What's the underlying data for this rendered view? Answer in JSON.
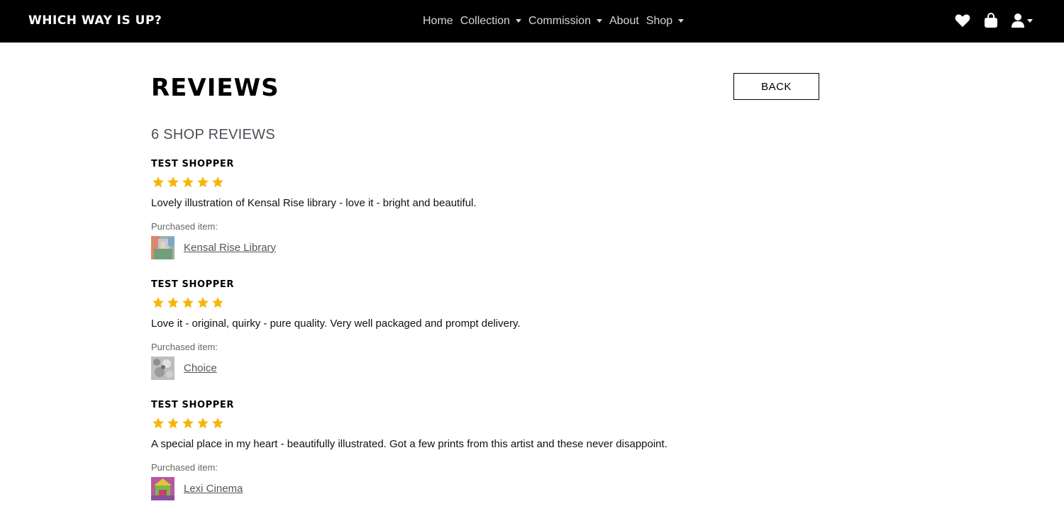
{
  "brand": "Which Way Is Up?",
  "nav": {
    "links": [
      {
        "label": "Home",
        "dropdown": false
      },
      {
        "label": "Collection",
        "dropdown": true
      },
      {
        "label": "Commission",
        "dropdown": true
      },
      {
        "label": "About",
        "dropdown": false
      },
      {
        "label": "Shop",
        "dropdown": true
      }
    ],
    "icons": [
      "heart-icon",
      "shopping-bag-icon",
      "user-icon"
    ]
  },
  "page": {
    "title": "Reviews",
    "back_label": "BACK",
    "count_label": "6 SHOP REVIEWS"
  },
  "reviews": [
    {
      "reviewer": "Test Shopper",
      "rating": 5,
      "text": "Lovely illustration of Kensal Rise library - love it - bright and beautiful.",
      "purchased_label": "Purchased item:",
      "item": "Kensal Rise Library"
    },
    {
      "reviewer": "Test Shopper",
      "rating": 5,
      "text": "Love it - original, quirky - pure quality. Very well packaged and prompt delivery.",
      "purchased_label": "Purchased item:",
      "item": "Choice"
    },
    {
      "reviewer": "Test Shopper",
      "rating": 5,
      "text": "A special place in my heart - beautifully illustrated. Got a few prints from this artist and these never disappoint.",
      "purchased_label": "Purchased item:",
      "item": "Lexi Cinema"
    }
  ],
  "colors": {
    "navbar_bg": "#000000",
    "star": "#f5b50a",
    "nav_text": "#d6d6d6"
  }
}
